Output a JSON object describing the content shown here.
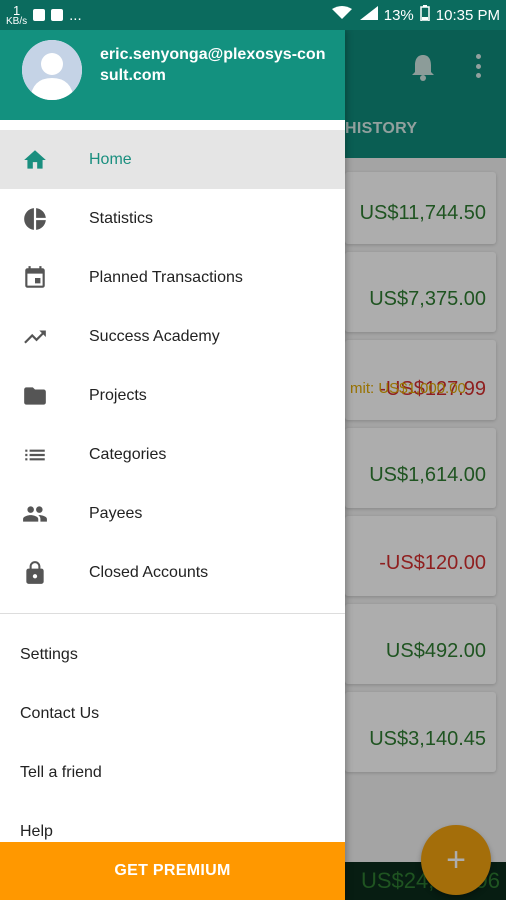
{
  "status_bar": {
    "left_number": "1",
    "left_sub": "KB/s",
    "ellipsis": "...",
    "battery": "13%",
    "time": "10:35 PM"
  },
  "background": {
    "tab_label": "HISTORY",
    "cards": [
      {
        "amount": "US$11,744.50",
        "kind": "positive"
      },
      {
        "amount": "US$7,375.00",
        "kind": "positive"
      },
      {
        "limit": "mit: US$1,000.00",
        "amount": "-US$127.99",
        "kind": "negative"
      },
      {
        "amount": "US$1,614.00",
        "kind": "positive"
      },
      {
        "amount": "-US$120.00",
        "kind": "negative"
      },
      {
        "amount": "US$492.00",
        "kind": "positive"
      },
      {
        "amount": "US$3,140.45",
        "kind": "positive"
      }
    ],
    "total": "US$24,117.96",
    "fab_label": "+"
  },
  "drawer": {
    "email": "eric.senyonga@plexosys-consult.com",
    "nav_items": [
      {
        "label": "Home",
        "icon": "home-icon",
        "active": true
      },
      {
        "label": "Statistics",
        "icon": "pie-chart-icon"
      },
      {
        "label": "Planned Transactions",
        "icon": "calendar-icon"
      },
      {
        "label": "Success Academy",
        "icon": "trending-up-icon"
      },
      {
        "label": "Projects",
        "icon": "folder-icon"
      },
      {
        "label": "Categories",
        "icon": "list-icon"
      },
      {
        "label": "Payees",
        "icon": "people-icon"
      },
      {
        "label": "Closed Accounts",
        "icon": "lock-icon"
      }
    ],
    "secondary_items": [
      "Settings",
      "Contact Us",
      "Tell a friend",
      "Help"
    ],
    "premium_button": "GET PREMIUM"
  },
  "colors": {
    "primary": "#13917f",
    "accent": "#ff9800",
    "positive": "#2e7d32",
    "negative": "#d32f2f"
  }
}
